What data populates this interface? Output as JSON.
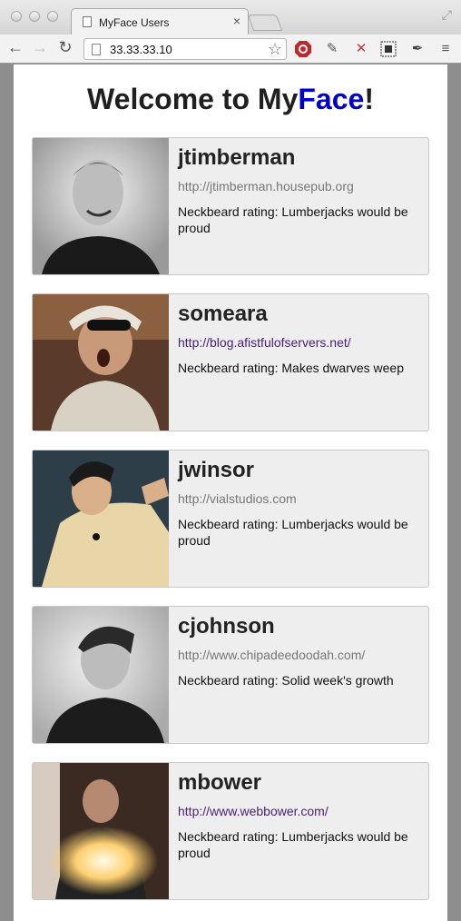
{
  "browser": {
    "tab_title": "MyFace Users",
    "tab_close": "×",
    "url": "33.33.33.10"
  },
  "page": {
    "heading_prefix": "Welcome to My",
    "heading_accent": "Face",
    "heading_suffix": "!"
  },
  "users": [
    {
      "name": "jtimberman",
      "url": "http://jtimberman.housepub.org",
      "rating": "Neckbeard rating: Lumberjacks would be proud"
    },
    {
      "name": "someara",
      "url": "http://blog.afistfulofservers.net/",
      "rating": "Neckbeard rating: Makes dwarves weep"
    },
    {
      "name": "jwinsor",
      "url": "http://vialstudios.com",
      "rating": "Neckbeard rating: Lumberjacks would be proud"
    },
    {
      "name": "cjohnson",
      "url": "http://www.chipadeedoodah.com/",
      "rating": "Neckbeard rating: Solid week's growth"
    },
    {
      "name": "mbower",
      "url": "http://www.webbower.com/",
      "rating": "Neckbeard rating: Lumberjacks would be proud"
    }
  ]
}
